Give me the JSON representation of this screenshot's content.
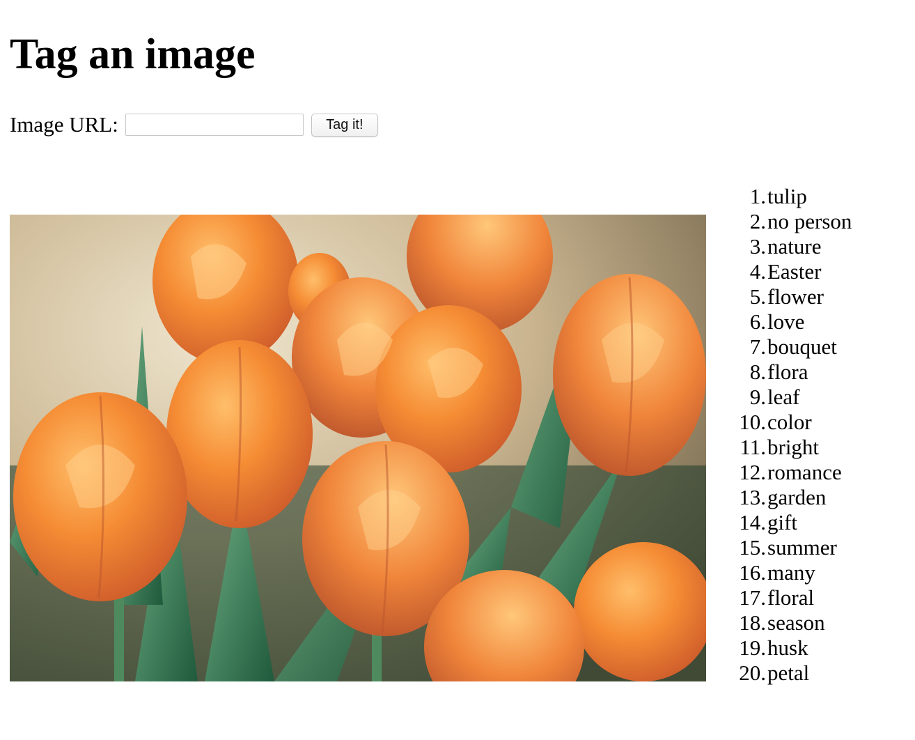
{
  "page": {
    "title": "Tag an image"
  },
  "form": {
    "label": "Image URL:",
    "input_value": "",
    "input_placeholder": "",
    "button_label": "Tag it!"
  },
  "image": {
    "subject": "bouquet of orange tulips with green leaves"
  },
  "tags": [
    {
      "num": "1.",
      "label": "tulip"
    },
    {
      "num": "2.",
      "label": "no person"
    },
    {
      "num": "3.",
      "label": "nature"
    },
    {
      "num": "4.",
      "label": "Easter"
    },
    {
      "num": "5.",
      "label": "flower"
    },
    {
      "num": "6.",
      "label": "love"
    },
    {
      "num": "7.",
      "label": "bouquet"
    },
    {
      "num": "8.",
      "label": "flora"
    },
    {
      "num": "9.",
      "label": "leaf"
    },
    {
      "num": "10.",
      "label": "color"
    },
    {
      "num": "11.",
      "label": "bright"
    },
    {
      "num": "12.",
      "label": "romance"
    },
    {
      "num": "13.",
      "label": "garden"
    },
    {
      "num": "14.",
      "label": "gift"
    },
    {
      "num": "15.",
      "label": "summer"
    },
    {
      "num": "16.",
      "label": "many"
    },
    {
      "num": "17.",
      "label": "floral"
    },
    {
      "num": "18.",
      "label": "season"
    },
    {
      "num": "19.",
      "label": "husk"
    },
    {
      "num": "20.",
      "label": "petal"
    }
  ]
}
